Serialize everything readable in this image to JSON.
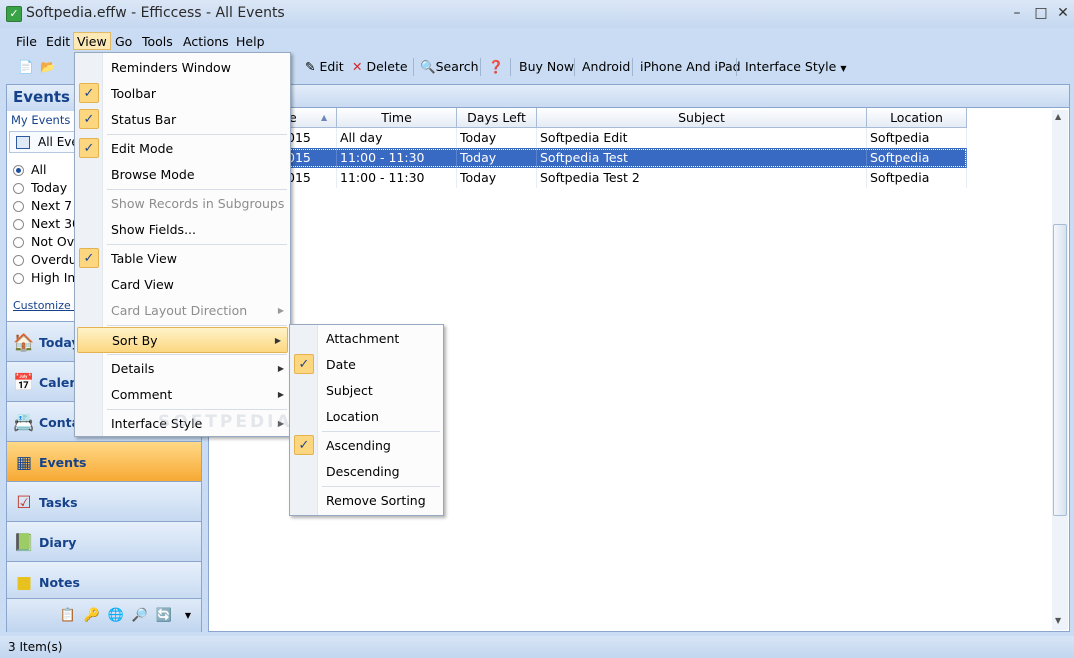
{
  "window": {
    "title": "Softpedia.effw - Efficcess - All Events",
    "minimize": "–",
    "maximize": "□",
    "close": "✕"
  },
  "menubar": [
    "File",
    "Edit",
    "View",
    "Go",
    "Tools",
    "Actions",
    "Help"
  ],
  "toolbar": {
    "edit": "Edit",
    "delete": "Delete",
    "search": "Search",
    "buy_now": "Buy Now",
    "android": "Android",
    "iphone": "iPhone And iPad",
    "interface_style": "Interface Style"
  },
  "left_panel": {
    "title": "Events",
    "my_events": "My Events",
    "filter_selected": "All Even",
    "filters": [
      "All",
      "Today",
      "Next 7",
      "Next 30",
      "Not Ove",
      "Overdu",
      "High Im"
    ],
    "customize": "Customize Cu",
    "nav": [
      "Today",
      "Calend",
      "Contac",
      "Events",
      "Tasks",
      "Diary",
      "Notes"
    ]
  },
  "table": {
    "columns": [
      "e",
      "Time",
      "Days Left",
      "Subject",
      "Location"
    ],
    "rows": [
      {
        "date": "015",
        "time": "All day",
        "days_left": "Today",
        "subject": "Softpedia Edit",
        "location": "Softpedia"
      },
      {
        "date": "015",
        "time": "11:00 - 11:30",
        "days_left": "Today",
        "subject": "Softpedia Test",
        "location": "Softpedia"
      },
      {
        "date": "015",
        "time": "11:00 - 11:30",
        "days_left": "Today",
        "subject": "Softpedia Test 2",
        "location": "Softpedia"
      }
    ]
  },
  "view_menu": {
    "reminders": "Reminders Window",
    "toolbar": "Toolbar",
    "status_bar": "Status Bar",
    "edit_mode": "Edit Mode",
    "browse_mode": "Browse Mode",
    "show_records": "Show Records in Subgroups",
    "show_fields": "Show Fields...",
    "table_view": "Table View",
    "card_view": "Card View",
    "card_layout": "Card Layout Direction",
    "sort_by": "Sort By",
    "details": "Details",
    "comment": "Comment",
    "interface_style": "Interface Style"
  },
  "sort_menu": {
    "attachment": "Attachment",
    "date": "Date",
    "subject": "Subject",
    "location": "Location",
    "ascending": "Ascending",
    "descending": "Descending",
    "remove": "Remove Sorting"
  },
  "check_mark": "✓",
  "submenu_arrow": "▶",
  "watermark": "SOFTPEDIA",
  "status": "3 Item(s)"
}
